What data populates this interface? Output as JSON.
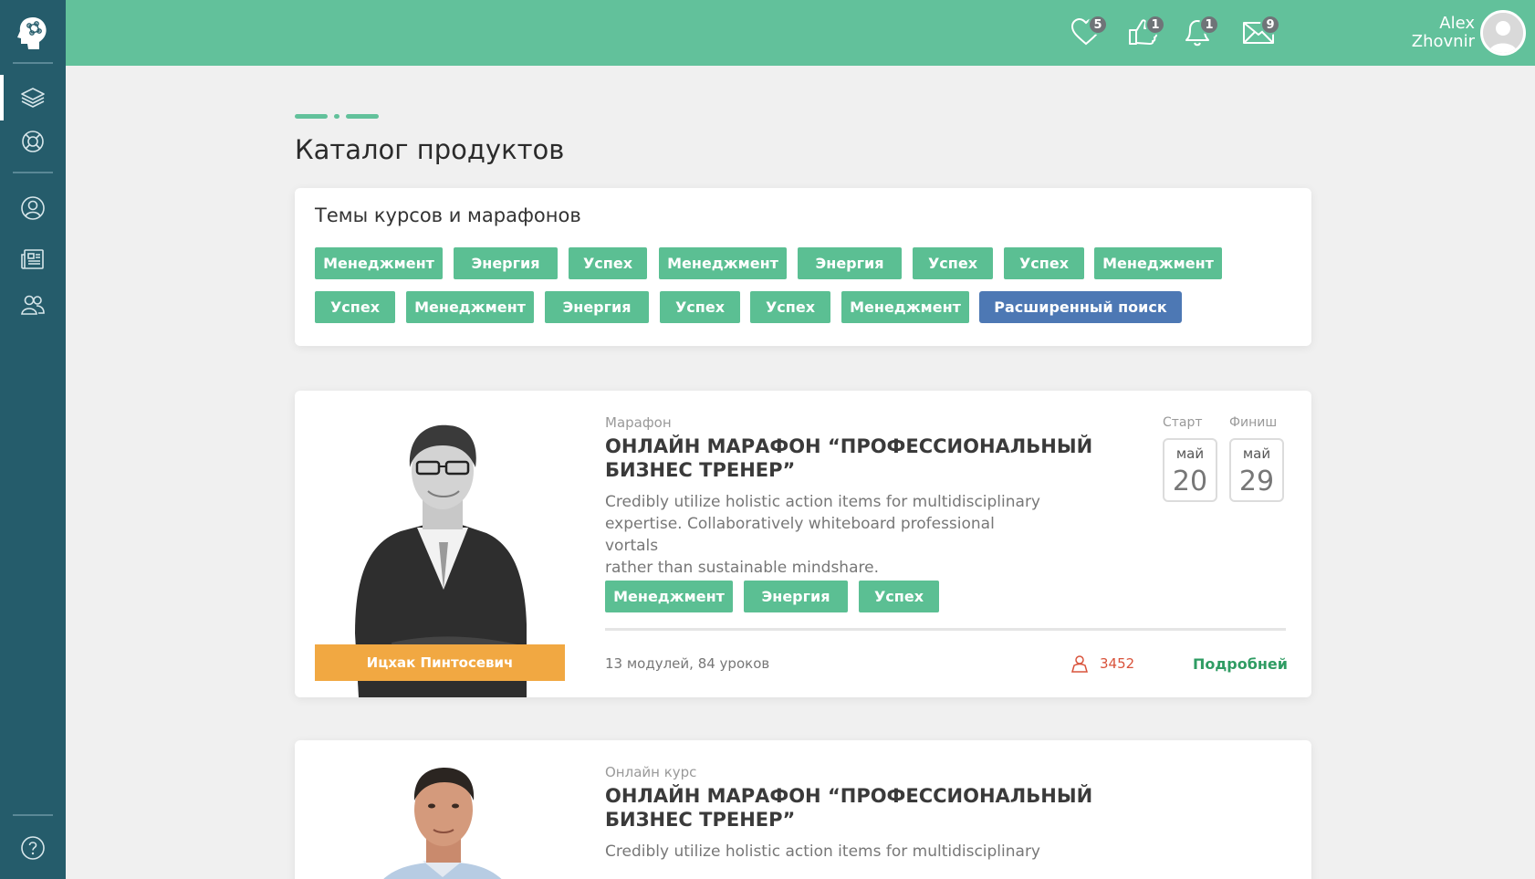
{
  "topbar": {
    "icons": [
      {
        "icon": "heart-icon",
        "count": "5"
      },
      {
        "icon": "thumbs-up-icon",
        "count": "1"
      },
      {
        "icon": "bell-icon",
        "count": "1"
      },
      {
        "icon": "mail-icon",
        "count": "9"
      }
    ],
    "user": {
      "first_name": "Alex",
      "last_name": "Zhovnir"
    }
  },
  "sidebar": {
    "items": [
      "courses-icon",
      "support-icon",
      "profile-icon",
      "news-icon",
      "groups-icon",
      "help-icon"
    ],
    "active": "courses-icon"
  },
  "page": {
    "title": "Каталог продуктов"
  },
  "topics": {
    "title": "Темы курсов и марафонов",
    "row1": [
      "Менеджмент",
      "Энергия",
      "Успех",
      "Менеджмент",
      "Энергия",
      "Успех",
      "Успех",
      "Менеджмент"
    ],
    "row2": [
      "Успех",
      "Менеджмент",
      "Энергия",
      "Успех",
      "Успех",
      "Менеджмент"
    ],
    "advanced_search": "Расширенный поиск"
  },
  "courses": [
    {
      "type": "Марафон",
      "title_line1": "ОНЛАЙН МАРАФОН “ПРОФЕССИОНАЛЬНЫЙ",
      "title_line2": "БИЗНЕС ТРЕНЕР”",
      "desc_line1": "Credibly utilize holistic action items for multidisciplinary",
      "desc_line2": "expertise. Collaboratively whiteboard professional vortals",
      "desc_line3": "rather than sustainable mindshare.",
      "tags": [
        "Менеджмент",
        "Энергия",
        "Успех"
      ],
      "start_label": "Старт",
      "finish_label": "Финиш",
      "start_month": "май",
      "start_day": "20",
      "finish_month": "май",
      "finish_day": "29",
      "modules": "13 модулей, 84 уроков",
      "participants": "3452",
      "more": "Подробней",
      "author": "Ицхак Пинтосевич"
    },
    {
      "type": "Онлайн курс",
      "title_line1": "ОНЛАЙН МАРАФОН “ПРОФЕССИОНАЛЬНЫЙ",
      "title_line2": "БИЗНЕС ТРЕНЕР”",
      "desc_line1": "Credibly utilize holistic action items for multidisciplinary"
    }
  ],
  "colors": {
    "sidebar": "#255c6b",
    "topbar": "#62c19b",
    "tag": "#5bbf93",
    "advanced_search": "#4d78b4",
    "author_label": "#f1a842",
    "participants": "#d9533b",
    "link": "#2f9c63"
  }
}
